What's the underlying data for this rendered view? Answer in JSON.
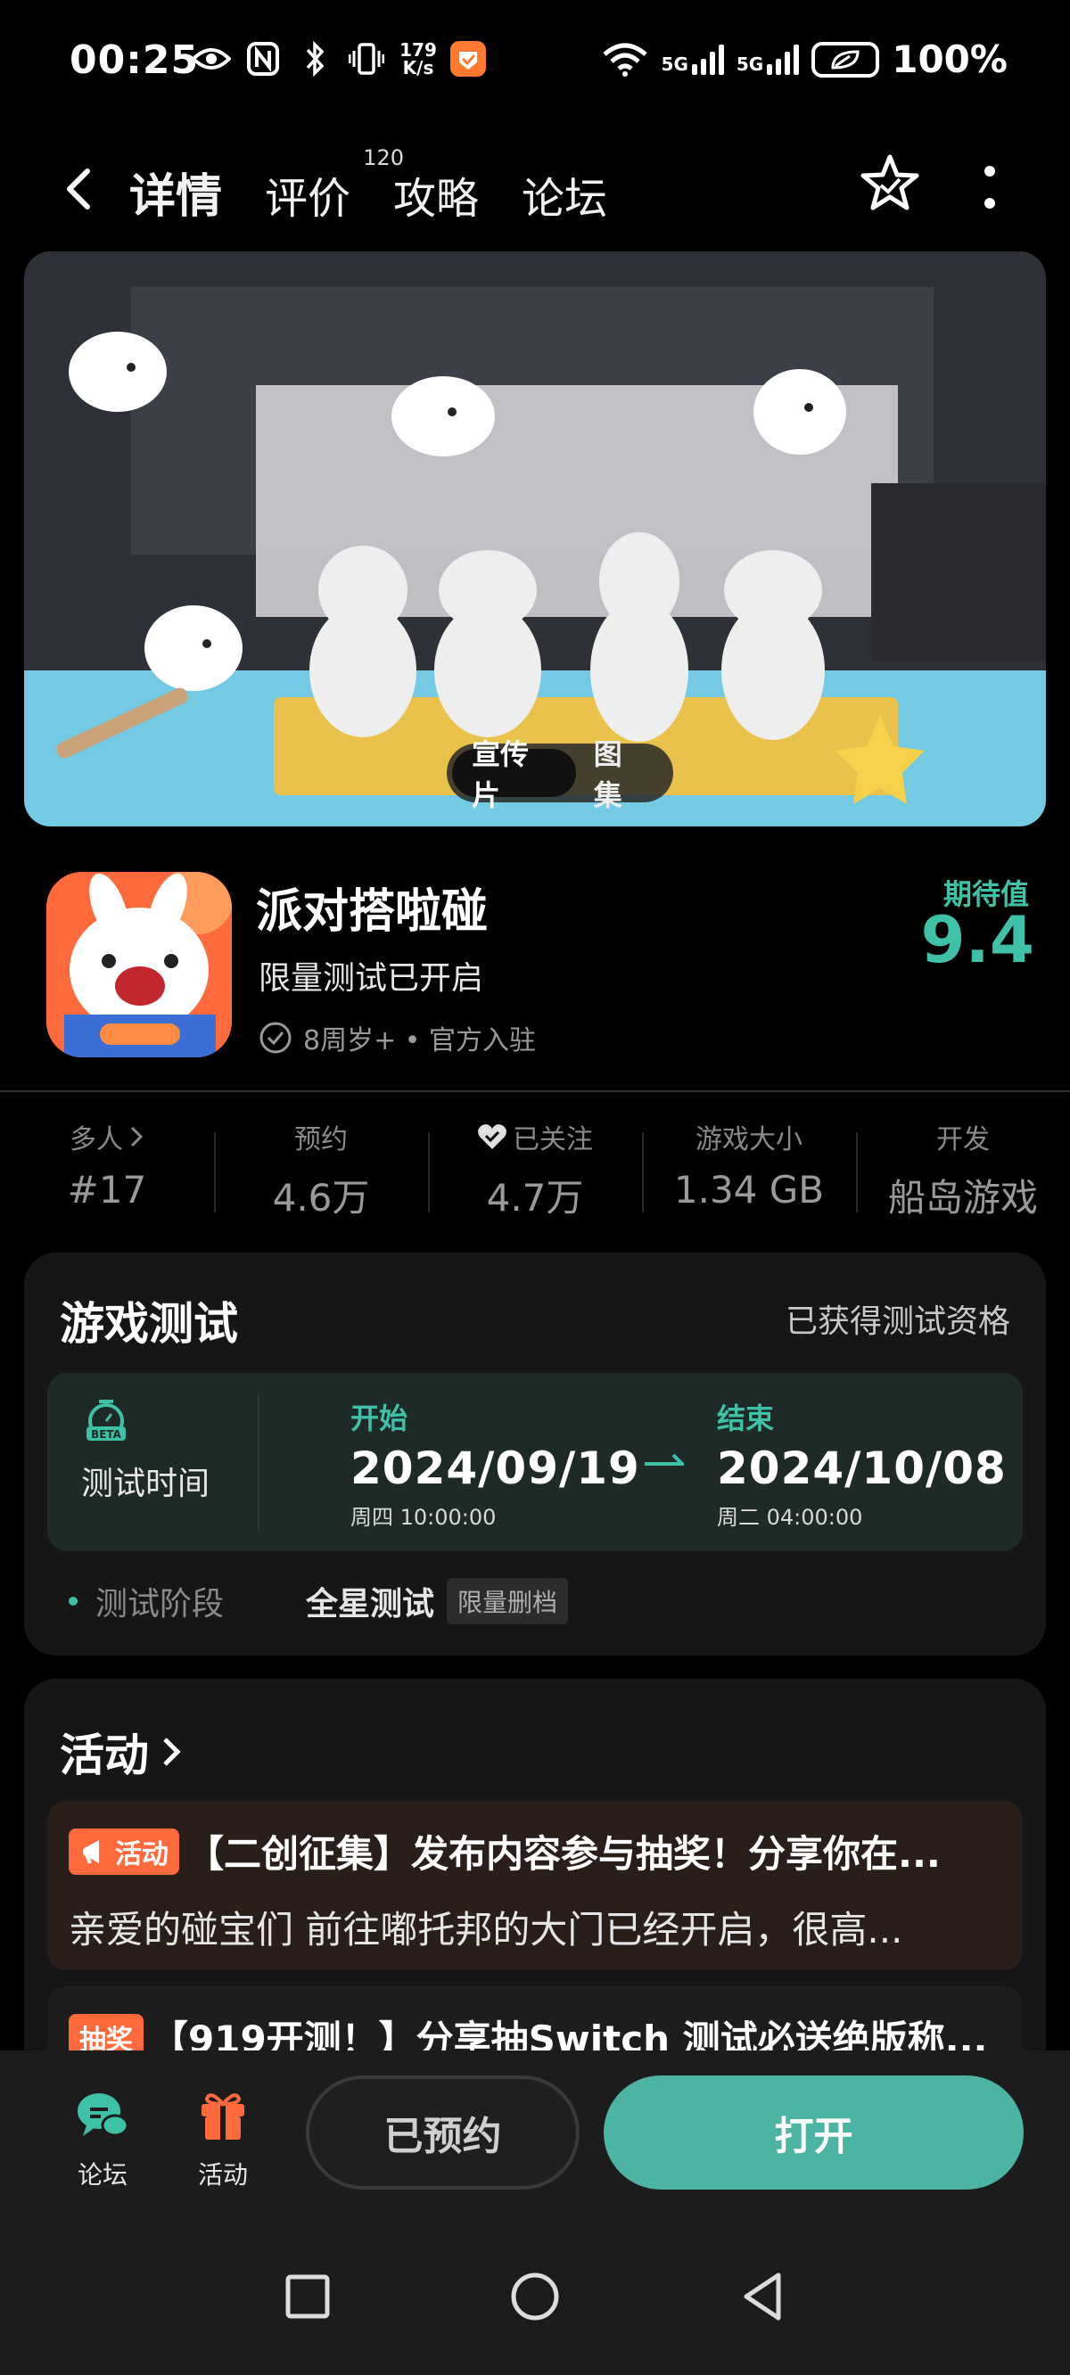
{
  "status_bar": {
    "time": "00:25",
    "net_speed": "179\nK/s",
    "network_5g_1": "5G",
    "network_5g_2": "5G",
    "battery": "100%"
  },
  "nav": {
    "tabs": [
      {
        "label": "详情",
        "active": true
      },
      {
        "label": "评价",
        "badge": "120"
      },
      {
        "label": "攻略"
      },
      {
        "label": "论坛"
      }
    ]
  },
  "media": {
    "switch": [
      "宣传片",
      "图集"
    ]
  },
  "game": {
    "title": "派对搭啦碰",
    "subtitle": "限量测试已开启",
    "meta": "8周岁+ • 官方入驻",
    "score_label": "期待值",
    "score_value": "9.4"
  },
  "stats": [
    {
      "label": "多人",
      "value": "#17",
      "chevron": true
    },
    {
      "label": "预约",
      "value": "4.6万"
    },
    {
      "label": "已关注",
      "value": "4.7万",
      "heart": true
    },
    {
      "label": "游戏大小",
      "value": "1.34 GB"
    },
    {
      "label": "开发",
      "value": "船岛游戏"
    }
  ],
  "test": {
    "title": "游戏测试",
    "qualification": "已获得测试资格",
    "time_label": "测试时间",
    "beta": "BETA",
    "start_label": "开始",
    "start_date": "2024/09/19",
    "start_time": "周四  10:00:00",
    "end_label": "结束",
    "end_date": "2024/10/08",
    "end_time": "周二  04:00:00",
    "stage_label": "测试阶段",
    "stage_value": "全星测试",
    "stage_tag": "限量删档"
  },
  "activities": {
    "title": "活动",
    "items": [
      {
        "tag": "活动",
        "title": "【二创征集】发布内容参与抽奖！分享你在...",
        "desc": "亲爱的碰宝们 前往嘟托邦的大门已经开启，很高..."
      },
      {
        "tag": "抽奖",
        "title": "【919开测！】分享抽Switch 测试必送绝版称...",
        "desc": ""
      }
    ]
  },
  "bottom_bar": {
    "forum": "论坛",
    "activity": "活动",
    "reserved": "已预约",
    "open": "打开"
  },
  "colors": {
    "accent": "#3fc1a8",
    "open_button": "#4db3a2",
    "tag_orange": "#ff6a3c"
  }
}
